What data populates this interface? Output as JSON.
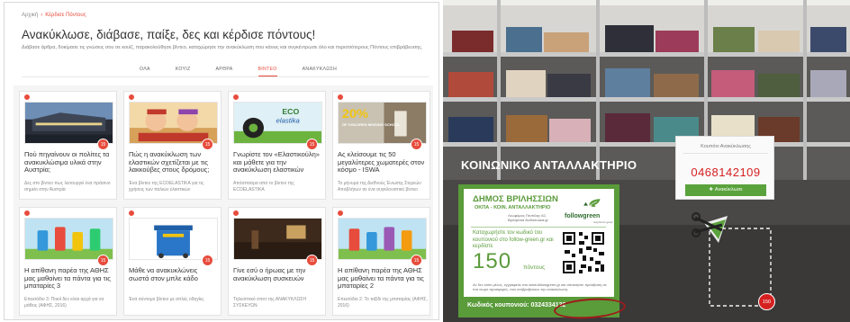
{
  "page": {
    "breadcrumb": {
      "home": "Αρχική",
      "current": "Κέρδισε Πόντους"
    },
    "title": "Ανακύκλωσε, διάβασε, παίξε, δες και κέρδισε πόντους!",
    "description": "Διάβασε άρθρα, δοκίμασε τις γνώσεις σου σε κουίζ, παρακολούθησε βίντεο, καταχώρησε την ανακύκλωση που κάνεις και συγκέντρωσε όλο και περισσότερους Πόντους επιβράβευσης.",
    "tabs": [
      {
        "label": "ΟΛΑ",
        "active": false
      },
      {
        "label": "ΚΟΥΙΖ",
        "active": false
      },
      {
        "label": "ΑΡΘΡΑ",
        "active": false
      },
      {
        "label": "ΒΙΝΤΕΟ",
        "active": true
      },
      {
        "label": "ΑΝΑΚΥΚΛΩΣΗ",
        "active": false
      }
    ],
    "cards": [
      {
        "title": "Πού πηγαίνουν οι πολίτες τα ανακυκλώσιμα υλικά στην Αυστρία;",
        "desc": "Δες στο βίντεο πως λειτουργεί ένα πράσινο σημείο στην Αυστρία",
        "points": "15",
        "icon": "photo-thumbnail"
      },
      {
        "title": "Πώς η ανακύκλωση των ελαστικών σχετίζεται με τις λακκούβες στους δρόμους;",
        "desc": "Ένα βίντεο της ECOELASTIKA για τις χρήσεις των παλιών ελαστικών",
        "points": "15",
        "icon": "cartoon-thumbnail"
      },
      {
        "title": "Γνωρίστε τον «Ελαστικούλη» και μάθετε για την ανακύκλωση ελαστικών",
        "desc": "Απόσπασμα από το βίντεο της ECOELASTIKA",
        "points": "15",
        "icon": "ecoelastika-thumbnail"
      },
      {
        "title": "Ας κλείσουμε τις 50 μεγαλύτερες χωματερές στον κόσμο - ISWA",
        "desc": "Το μήνυμα της Διεθνούς Ένωσης Στερεών Αποβλήτων σε ένα συγκλονιστικό βίντεο",
        "points": "15",
        "icon": "iswa-thumbnail"
      },
      {
        "title": "Η απίθανη παρέα της ΑΘΗΣ μας μαθαίνει τα πάντα για τις μπαταρίες 3",
        "desc": "Επεισόδιο 3: Ποιοί δεν είναι αρχά για να μάθεις (ΑΦΗΣ, 2016)",
        "points": "15",
        "icon": "battery-cartoon-thumbnail"
      },
      {
        "title": "Μάθε να ανακυκλώνεις σωστά στον μπλε κάδο",
        "desc": "Ένα σύντομο βίντεο με απλές οδηγίες",
        "points": "15",
        "icon": "blue-bin-thumbnail"
      },
      {
        "title": "Γίνε εσύ ο ήρωας με την ανακύκλωση συσκευών",
        "desc": "Τηλεοπτικό σποτ της ΑΝΑΚΥΚΛΩΣΗ ΣΥΣΚΕΥΩΝ",
        "points": "15",
        "icon": "dark-scene-thumbnail"
      },
      {
        "title": "Η απίθανη παρέα της ΑΘΗΣ μας μαθαίνει τα πάντα για τις μπαταρίες 2",
        "desc": "Επεισόδιο 2: Το ταξίδι της μπαταρίας (ΑΦΗΣ, 2016)",
        "points": "15",
        "icon": "battery-cartoon-thumbnail"
      }
    ],
    "thumb_texts": {
      "eco": "ECO",
      "elastika": "elastika",
      "iswa_big": "20%",
      "iswa_small": "OF CHILDREN MISSING SCHOOL"
    }
  },
  "photo": {
    "store_title": "ΚΟΙΝΩΝΙΚΟ ΑΝΤΑΛΛΑΚΤΗΡΙΟ",
    "voucher": {
      "municipality": "ΔΗΜΟΣ ΒΡΙΛΗΣΣΙΩΝ",
      "subtitle": "ΟΚΠΑ - ΚΟΙΝ. ΑΝΤΑΛΛΑΚΤΗΡΙΟ",
      "address": "Λεωφόρος Πεντέλης 62, Βριλήσσια διαδικτυακά.gr",
      "logo": "followgreen",
      "logo_sub": "recycle for good",
      "text": "Καταχωρήστε τον κωδικό του κουπονιού στο follow-green.gr και κερδίστε",
      "points_number": "150",
      "points_word": "πόντους",
      "fine_print": "Αν δεν είστε μέλος, εγγραφείτε στο www.followgreen.gr και αποκτήστε πρόσβαση σε ένα σωρό προσφορές, που επιβραβεύουν την ανακύκλωση.",
      "code_label": "Κωδικός κουπονιού: 0324334132"
    },
    "coupon_card": {
      "title": "Κουπόνι Ανακύκλωσης",
      "number": "0468142109",
      "button_label": "Ανακύκλωσε"
    },
    "badge": "150"
  },
  "colors": {
    "accent_red": "#e74c3c",
    "green": "#5a9b3a",
    "coupon_red": "#d62020"
  }
}
